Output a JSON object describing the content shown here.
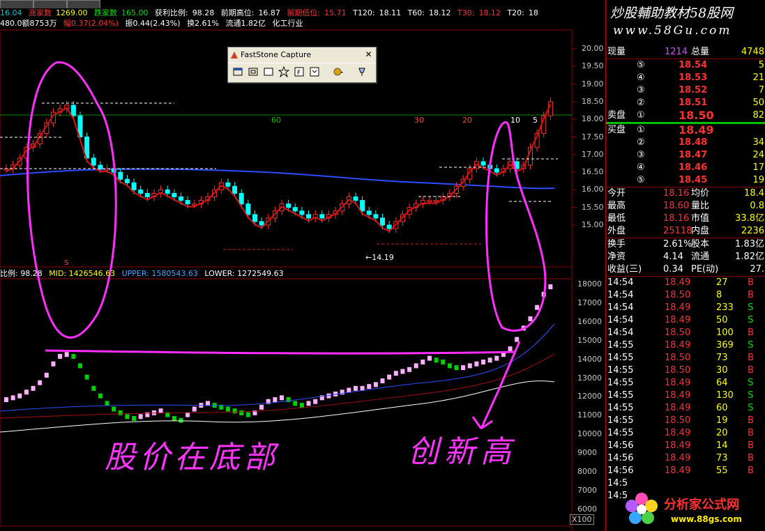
{
  "title_bar": {
    "rise_count_label": "涨家数",
    "rise_count_value": "1269.00",
    "fall_count_label": "跌家数",
    "fall_count_value": "165.00",
    "profit_ratio_label": "获利比例:",
    "profit_ratio_value": "98.28",
    "prev_high_label": "前期高位:",
    "prev_high_value": "16.87",
    "prev_low_label": "前期低位:",
    "prev_low_value": "15.71",
    "t120_label": "T120:",
    "t120_value": "18.11",
    "t60_label": "T60:",
    "t60_value": "18.12",
    "t30_label": "T30:",
    "t30_value": "18.12",
    "t20_label": "T20:",
    "t20_value": "18",
    "left_value": "16.04"
  },
  "info_line": {
    "amount": "480.0额8753万",
    "change": "幅0.37(2.04%)",
    "amplitude": "振0.44(2.43%)",
    "turnover": "换2.61%",
    "float_cap": "流通1.82亿",
    "industry": "化工行业"
  },
  "price_axis": [
    "20.00",
    "19.50",
    "19.00",
    "18.50",
    "18.00",
    "17.50",
    "17.00",
    "16.50",
    "16.00",
    "15.50",
    "15.00"
  ],
  "indicator_axis": [
    "18000",
    "17000",
    "16000",
    "15000",
    "14000",
    "13000",
    "12000",
    "11000",
    "10000",
    "9000",
    "8000",
    "7000",
    "6000"
  ],
  "chart_labels": {
    "ma_60": "60",
    "ma_30": "30",
    "ma_20": "20",
    "ma_10": "10",
    "ma_5": "5",
    "low_marker": "←14.19",
    "marker_s": "S"
  },
  "boll_line": {
    "ratio_label": "比例: 98.28",
    "mid_label": "MID: 1426546.63",
    "upper_label": "UPPER: 1580543.63",
    "lower_label": "LOWER: 1272549.63"
  },
  "annotations": {
    "left_handwriting": "股价在底部",
    "right_handwriting": "创新高"
  },
  "faststone": {
    "title": "FastStone Capture",
    "close": "✕"
  },
  "logo_site": {
    "name": "炒股輔助教材58股网",
    "url": "www.58Gu.com"
  },
  "logo_bottom": {
    "name": "分析家公式网",
    "url": "www.88gs.com"
  },
  "scale_badge": "X100",
  "quote": {
    "volume_label": "现量",
    "volume_value": "1214",
    "total_label": "总量",
    "total_value": "4748",
    "sell_label": "卖盘",
    "buy_label": "买盘",
    "sells": [
      {
        "level": "⑤",
        "price": "18.54",
        "vol": "5"
      },
      {
        "level": "④",
        "price": "18.53",
        "vol": "21"
      },
      {
        "level": "③",
        "price": "18.52",
        "vol": "7"
      },
      {
        "level": "②",
        "price": "18.51",
        "vol": "50"
      },
      {
        "level": "①",
        "price": "18.50",
        "vol": "82"
      }
    ],
    "buys": [
      {
        "level": "①",
        "price": "18.49",
        "vol": ""
      },
      {
        "level": "②",
        "price": "18.48",
        "vol": "34"
      },
      {
        "level": "③",
        "price": "18.47",
        "vol": "24"
      },
      {
        "level": "④",
        "price": "18.46",
        "vol": "17"
      },
      {
        "level": "⑤",
        "price": "18.45",
        "vol": "19"
      }
    ],
    "stats": [
      {
        "l1": "今开",
        "v1": "18.16",
        "l2": "均价",
        "v2": "18.4"
      },
      {
        "l1": "最高",
        "v1": "18.60",
        "l2": "量比",
        "v2": "0.8"
      },
      {
        "l1": "最低",
        "v1": "18.16",
        "l2": "市值",
        "v2": "33.8亿"
      },
      {
        "l1": "外盘",
        "v1": "25118",
        "l2": "内盘",
        "v2": "2236"
      }
    ],
    "stats2": [
      {
        "l1": "换手",
        "v1": "2.61%",
        "l2": "股本",
        "v2": "1.83亿"
      },
      {
        "l1": "净资",
        "v1": "4.14",
        "l2": "流通",
        "v2": "1.82亿"
      },
      {
        "l1": "收益(三)",
        "v1": "0.34",
        "l2": "PE(动)",
        "v2": "27."
      }
    ],
    "ticks": [
      {
        "time": "14:54",
        "price": "18.49",
        "vol": "27",
        "side": "B"
      },
      {
        "time": "14:54",
        "price": "18.50",
        "vol": "8",
        "side": "B"
      },
      {
        "time": "14:54",
        "price": "18.49",
        "vol": "233",
        "side": "S"
      },
      {
        "time": "14:54",
        "price": "18.49",
        "vol": "50",
        "side": "S"
      },
      {
        "time": "14:54",
        "price": "18.50",
        "vol": "100",
        "side": "B"
      },
      {
        "time": "14:55",
        "price": "18.49",
        "vol": "369",
        "side": "S"
      },
      {
        "time": "14:55",
        "price": "18.50",
        "vol": "73",
        "side": "B"
      },
      {
        "time": "14:55",
        "price": "18.50",
        "vol": "30",
        "side": "B"
      },
      {
        "time": "14:55",
        "price": "18.49",
        "vol": "64",
        "side": "S"
      },
      {
        "time": "14:55",
        "price": "18.49",
        "vol": "130",
        "side": "S"
      },
      {
        "time": "14:55",
        "price": "18.49",
        "vol": "60",
        "side": "S"
      },
      {
        "time": "14:55",
        "price": "18.50",
        "vol": "19",
        "side": "B"
      },
      {
        "time": "14:55",
        "price": "18.49",
        "vol": "20",
        "side": "B"
      },
      {
        "time": "14:56",
        "price": "18.49",
        "vol": "14",
        "side": "B"
      },
      {
        "time": "14:56",
        "price": "18.49",
        "vol": "73",
        "side": "B"
      },
      {
        "time": "14:56",
        "price": "18.49",
        "vol": "55",
        "side": "B"
      },
      {
        "time": "14:5",
        "price": "",
        "vol": "",
        "side": ""
      },
      {
        "time": "14:5",
        "price": "",
        "vol": "",
        "side": ""
      }
    ]
  }
}
